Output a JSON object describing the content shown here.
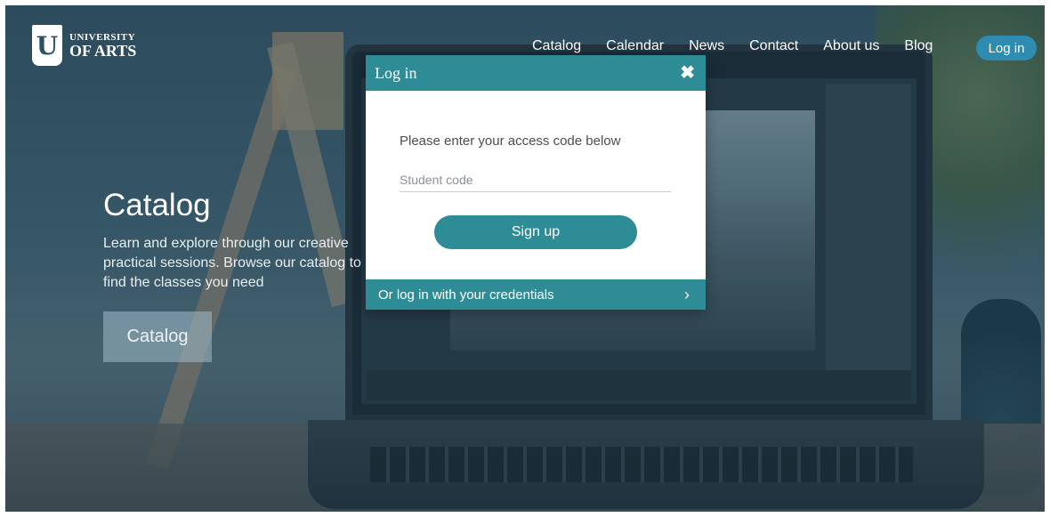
{
  "brand": {
    "mark": "U",
    "line1": "UNIVERSITY",
    "line2": "OF ARTS"
  },
  "nav": {
    "items": [
      "Catalog",
      "Calendar",
      "News",
      "Contact",
      "About us",
      "Blog"
    ],
    "login_label": "Log in"
  },
  "hero": {
    "title": "Catalog",
    "description": "Learn and explore through our creative practical sessions. Browse our catalog to find the classes you need",
    "button_label": "Catalog"
  },
  "modal": {
    "title": "Log in",
    "close_icon": "✖",
    "prompt": "Please enter your access code below",
    "input_placeholder": "Student code",
    "submit_label": "Sign up",
    "footer_link": "Or log in with your credentials",
    "footer_icon": "›"
  },
  "colors": {
    "accent": "#2e8c96",
    "login_button": "#2e8cb0"
  }
}
